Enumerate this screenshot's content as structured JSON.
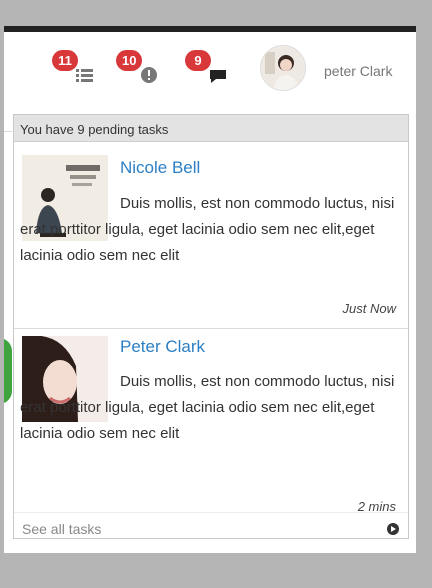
{
  "header": {
    "notifications": [
      {
        "count": "11",
        "icon": "list-icon"
      },
      {
        "count": "10",
        "icon": "alert-icon"
      },
      {
        "count": "9",
        "icon": "chat-icon"
      }
    ],
    "user": {
      "name": "peter Clark"
    }
  },
  "dropdown": {
    "title": "You have 9 pending tasks",
    "tasks": [
      {
        "name": "Nicole Bell",
        "body": "Duis mollis, est non commodo luctus, nisi erat porttitor ligula, eget lacinia odio sem nec elit,eget lacinia odio sem nec elit",
        "time": "Just Now"
      },
      {
        "name": "Peter Clark",
        "body": "Duis mollis, est non commodo luctus, nisi erat porttitor ligula, eget lacinia odio sem nec elit,eget lacinia odio sem nec elit",
        "time": "2 mins"
      }
    ],
    "footer": "See all tasks"
  },
  "colors": {
    "badge": "#d9383a",
    "link": "#2c7fc4",
    "accent_green": "#3fa33f"
  }
}
